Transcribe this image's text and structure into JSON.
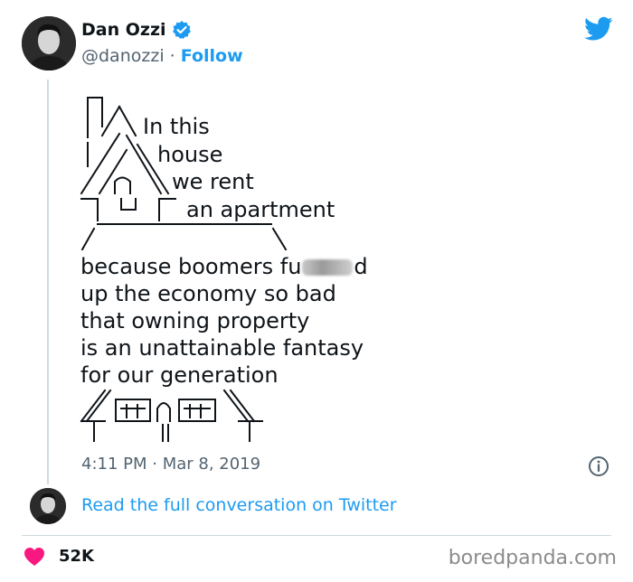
{
  "author": {
    "name": "Dan Ozzi",
    "handle": "@danozzi",
    "separator": "·",
    "follow_label": "Follow"
  },
  "icons": {
    "verified": "verified-badge-icon",
    "twitter": "twitter-bird-icon",
    "info": "info-icon",
    "heart": "heart-icon"
  },
  "colors": {
    "accent": "#1d9bf0",
    "text": "#0f1419",
    "muted": "#536471",
    "heart": "#f91880"
  },
  "tweet": {
    "roof_lines": [
      "In this",
      "house",
      "we rent",
      "an apartment"
    ],
    "body_line_1_start": "because boomers fu",
    "body_line_1_end": "d",
    "body_lines": [
      "up the economy so bad",
      "that owning property",
      "is an unattainable fantasy",
      "for our generation"
    ],
    "timestamp": "4:11 PM · Mar 8, 2019"
  },
  "read_more": "Read the full conversation on Twitter",
  "likes": "52K",
  "watermark": "boredpanda.com"
}
